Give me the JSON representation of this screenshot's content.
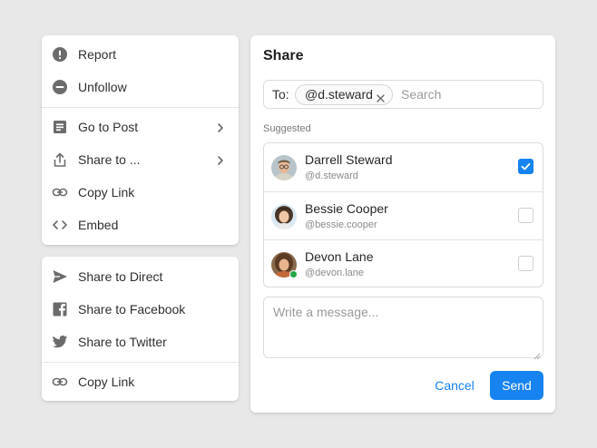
{
  "menu_primary": {
    "items": [
      {
        "label": "Report",
        "icon": "alert-circle-icon"
      },
      {
        "label": "Unfollow",
        "icon": "minus-circle-icon"
      },
      {
        "label": "Go to Post",
        "icon": "document-icon",
        "has_submenu": true
      },
      {
        "label": "Share to ...",
        "icon": "share-icon",
        "has_submenu": true
      },
      {
        "label": "Copy Link",
        "icon": "link-icon"
      },
      {
        "label": "Embed",
        "icon": "code-icon"
      }
    ]
  },
  "menu_secondary": {
    "items": [
      {
        "label": "Share to Direct",
        "icon": "send-icon"
      },
      {
        "label": "Share to Facebook",
        "icon": "facebook-icon"
      },
      {
        "label": "Share to Twitter",
        "icon": "twitter-icon"
      },
      {
        "label": "Copy Link",
        "icon": "link-icon"
      }
    ]
  },
  "share": {
    "title": "Share",
    "to_label": "To:",
    "recipient_chip": "@d.steward",
    "search_placeholder": "Search",
    "suggested_label": "Suggested",
    "suggestions": [
      {
        "name": "Darrell Steward",
        "handle": "@d.steward",
        "checked": true,
        "online": false
      },
      {
        "name": "Bessie Cooper",
        "handle": "@bessie.cooper",
        "checked": false,
        "online": false
      },
      {
        "name": "Devon Lane",
        "handle": "@devon.lane",
        "checked": false,
        "online": true
      }
    ],
    "message_placeholder": "Write a message...",
    "cancel_label": "Cancel",
    "send_label": "Send"
  },
  "colors": {
    "accent": "#1683f0",
    "icon_gray": "#6b6b6b",
    "online": "#22a745",
    "background": "#e8e8e8"
  }
}
